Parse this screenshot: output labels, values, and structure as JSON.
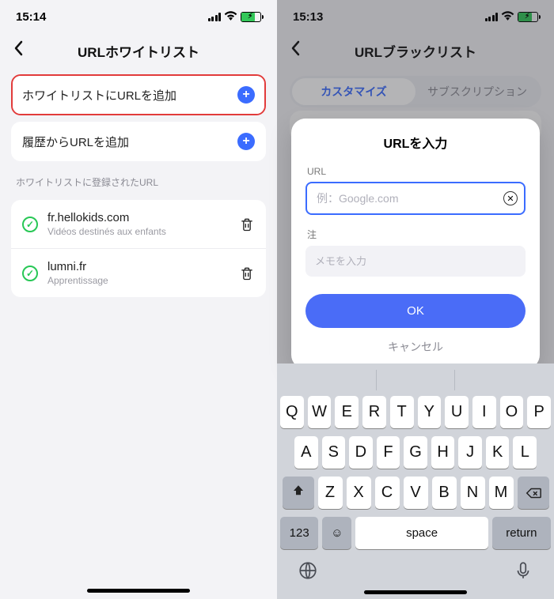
{
  "left": {
    "time": "15:14",
    "title": "URLホワイトリスト",
    "add_whitelist": "ホワイトリストにURLを追加",
    "add_history": "履歴からURLを追加",
    "section": "ホワイトリストに登録されたURL",
    "items": [
      {
        "url": "fr.hellokids.com",
        "desc": "Vidéos destinés aux enfants"
      },
      {
        "url": "lumni.fr",
        "desc": "Apprentissage"
      }
    ]
  },
  "right": {
    "time": "15:13",
    "title": "URLブラックリスト",
    "tab_custom": "カスタマイズ",
    "tab_sub": "サブスクリプション",
    "modal": {
      "title": "URLを入力",
      "url_label": "URL",
      "url_placeholder": "例：Google.com",
      "note_label": "注",
      "note_placeholder": "メモを入力",
      "ok": "OK",
      "cancel": "キャンセル"
    },
    "kb": {
      "r1": [
        "Q",
        "W",
        "E",
        "R",
        "T",
        "Y",
        "U",
        "I",
        "O",
        "P"
      ],
      "r2": [
        "A",
        "S",
        "D",
        "F",
        "G",
        "H",
        "J",
        "K",
        "L"
      ],
      "r3": [
        "Z",
        "X",
        "C",
        "V",
        "B",
        "N",
        "M"
      ],
      "num": "123",
      "space": "space",
      "ret": "return"
    }
  }
}
